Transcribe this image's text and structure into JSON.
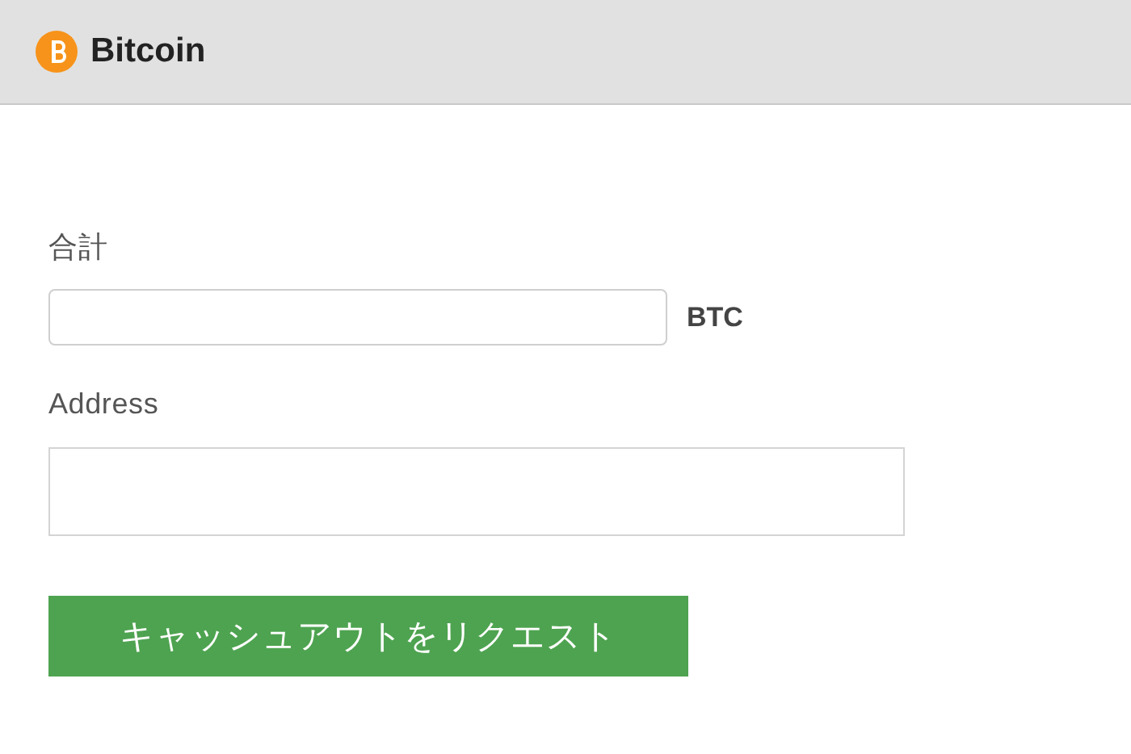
{
  "header": {
    "title": "Bitcoin"
  },
  "amount": {
    "label": "合計",
    "unit": "BTC"
  },
  "address": {
    "label": "Address"
  },
  "submit_button": {
    "label": "キャッシュアウトをリクエスト"
  }
}
